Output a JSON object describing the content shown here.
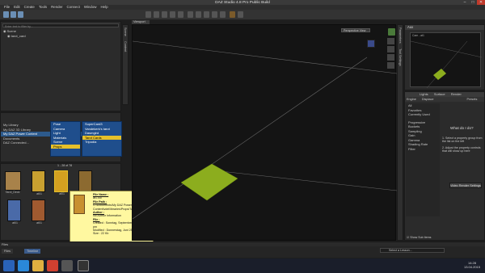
{
  "window": {
    "title": "DAZ Studio 4.8 Pro Public Build",
    "minimize": "–",
    "maximize": "□",
    "close": "✕"
  },
  "menu": [
    "File",
    "Edit",
    "Create",
    "Tools",
    "Render",
    "Connect",
    "Window",
    "Help"
  ],
  "left_top": {
    "header": "Scene",
    "search_placeholder": "Enter text to filter by...",
    "items": [
      "Scene",
      "tarot_card"
    ]
  },
  "left_mid": {
    "content_tree": [
      "My Library",
      "My DAZ 3D Library",
      "My DAZ Power Content",
      "Documents",
      "DAZ Connected..."
    ],
    "submenu1": [
      "Pose",
      "Camera",
      "Light",
      "Materials",
      "Scene",
      "Props"
    ],
    "submenu2": [
      "SuperCard3",
      "Vandekerk's tarot",
      "Dasmgird",
      "Tarot Cards",
      "Tripodia"
    ],
    "highlight1": "Props",
    "highlight2": "Tarot Cards"
  },
  "thumbs": {
    "count": "1 - 28 of 78",
    "row1": [
      "Tarot_Deck",
      "at01",
      "at01",
      "at01"
    ],
    "row2": [
      "at01",
      "at01"
    ]
  },
  "tooltip": {
    "file_name_label": "File Name :",
    "file_name": "at1.cui",
    "file_path_label": "File Path :",
    "file_path": "G:\\Documents\\My DAZ Power Content\\vdel\\libraries\\Props\\Tarot Cards",
    "author_label": "Author :",
    "author": "No Author Information",
    "file_label": "File :",
    "created": "Created :  Sonntag, September 14 2014 8:44 pm",
    "modified": "Modified : Donnerstag, Juni 25 2012 6:32 pm",
    "size": "Size :        22 Kb"
  },
  "viewport": {
    "tab": "Viewport",
    "camera": "Perspective View"
  },
  "right": {
    "preview_header": "Aux",
    "preview_label": "Cam - at1",
    "tabs": [
      "Lights",
      "Surface",
      "Render"
    ],
    "subtabs": [
      "Engine",
      "Displace",
      "Presets"
    ],
    "list": [
      "All",
      "Favorites",
      "Currently Used",
      "Progressive",
      "Buckets",
      "Sampling",
      "Gain",
      "Gamma",
      "Shading Rate",
      "Filter"
    ],
    "help_title": "What do I do?",
    "help_steps": [
      "1. Select a property group from the list on the left",
      "2. Adjust the property controls that will show up here"
    ],
    "render_button": "Video Render Settings",
    "show_subitems": "Show Sub Items"
  },
  "bottom_tabs": [
    "Files",
    "Timeline"
  ],
  "status": {
    "select_lesson": "Select a Lesson..."
  },
  "clock": {
    "time": "14:28",
    "date": "13.04.2015"
  }
}
